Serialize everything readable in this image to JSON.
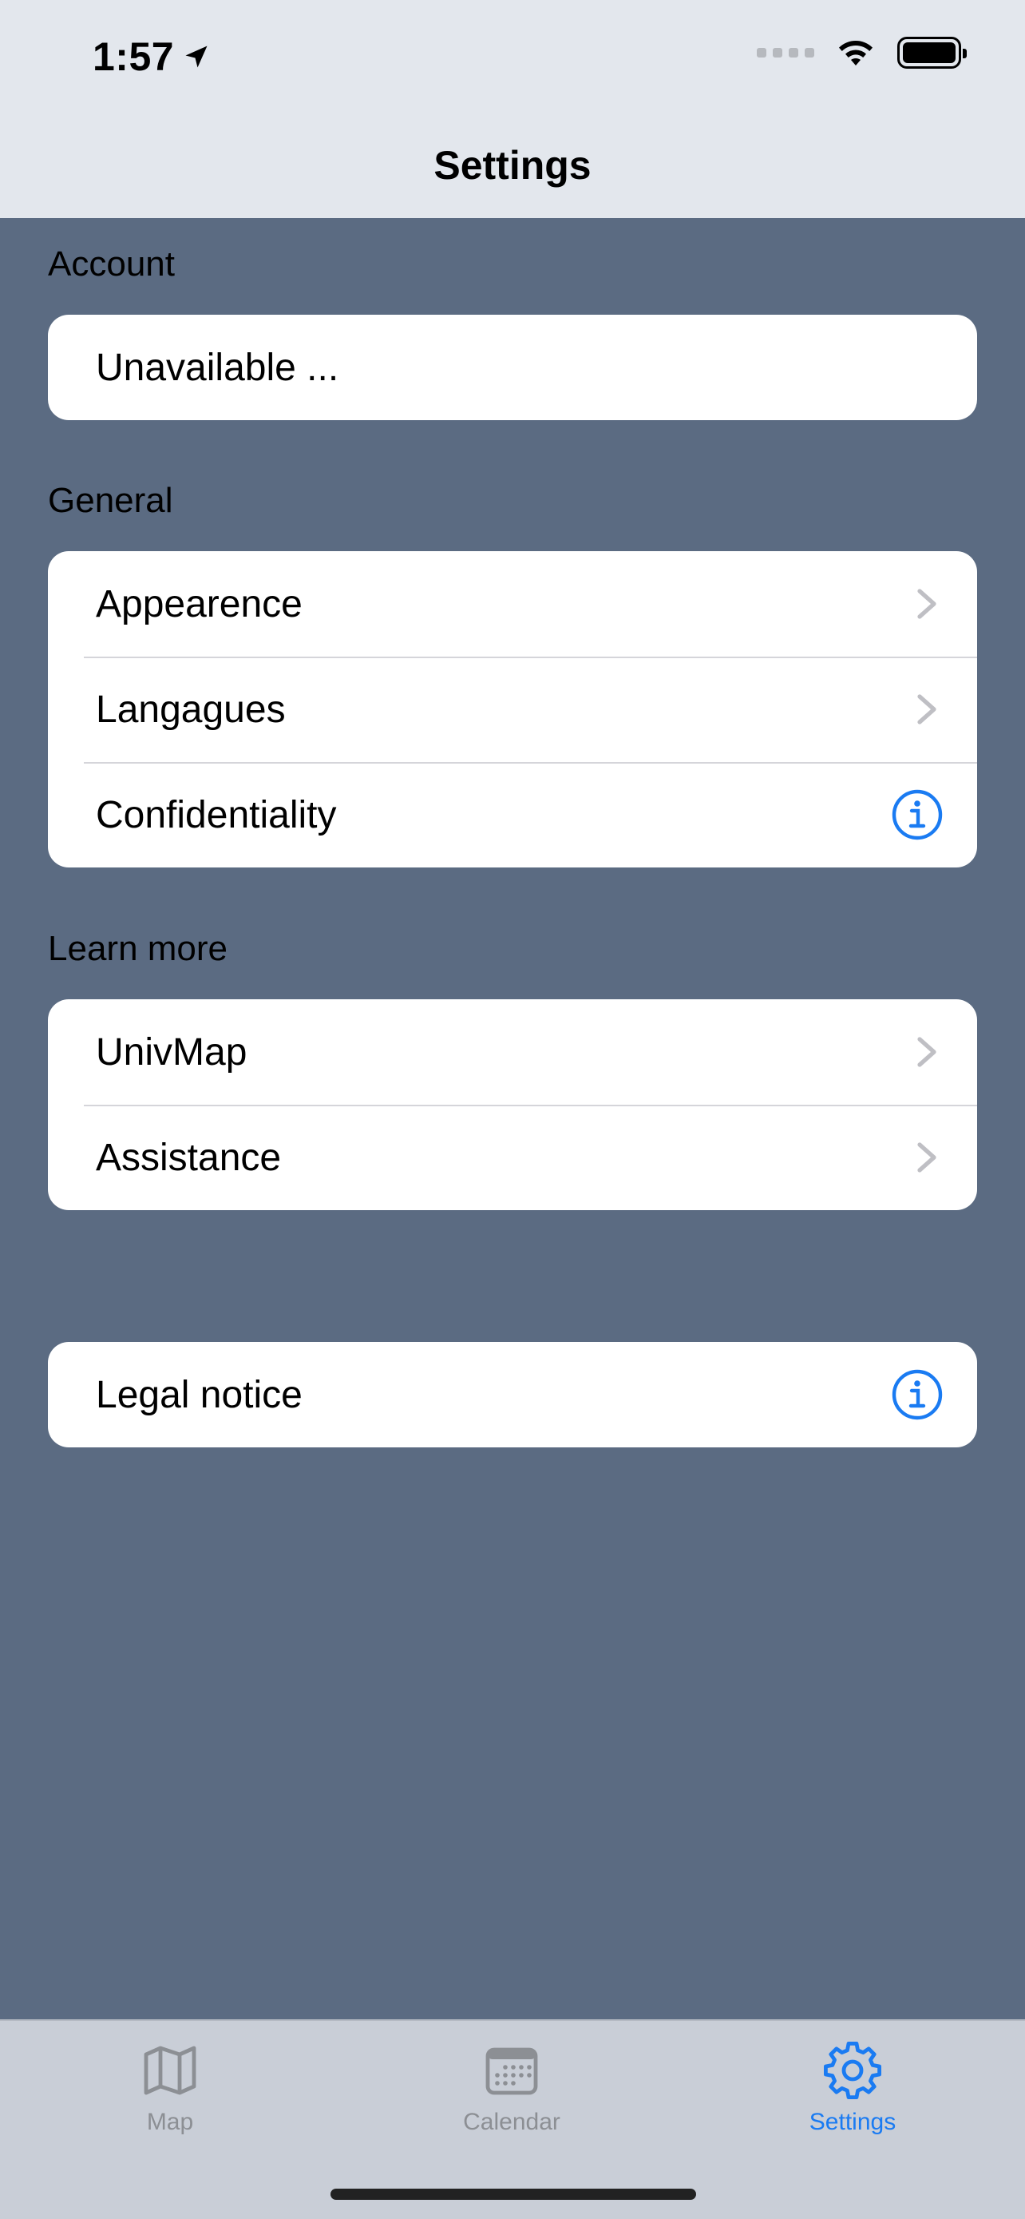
{
  "status_bar": {
    "time": "1:57"
  },
  "nav": {
    "title": "Settings"
  },
  "sections": {
    "account": {
      "header": "Account",
      "rows": [
        "Unavailable ..."
      ]
    },
    "general": {
      "header": "General",
      "rows": [
        {
          "label": "Appearence",
          "accessory": "chevron-right-icon"
        },
        {
          "label": "Langagues",
          "accessory": "chevron-right-icon"
        },
        {
          "label": "Confidentiality",
          "accessory": "info-icon"
        }
      ]
    },
    "learn_more": {
      "header": "Learn more",
      "rows": [
        {
          "label": "UnivMap",
          "accessory": "chevron-right-icon"
        },
        {
          "label": "Assistance",
          "accessory": "chevron-right-icon"
        }
      ]
    },
    "legal": {
      "rows": [
        {
          "label": "Legal notice",
          "accessory": "info-icon"
        }
      ]
    }
  },
  "tabbar": {
    "tabs": [
      {
        "label": "Map",
        "icon": "map-icon",
        "active": false
      },
      {
        "label": "Calendar",
        "icon": "calendar-icon",
        "active": false
      },
      {
        "label": "Settings",
        "icon": "gear-icon",
        "active": true
      }
    ]
  },
  "colors": {
    "accent": "#1a7bf2",
    "background": "#5b6b82",
    "nav_background": "#e3e7ed",
    "tabbar_background": "#c9ced7",
    "inactive_tab": "#8c8f94"
  }
}
